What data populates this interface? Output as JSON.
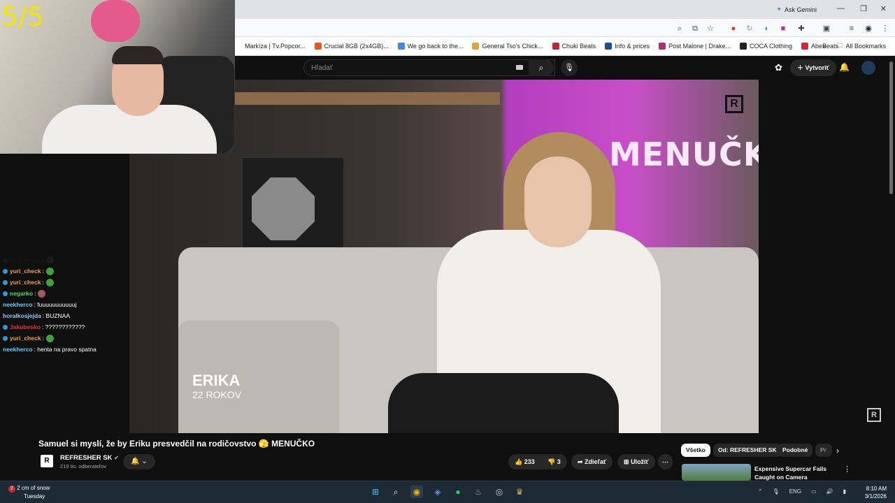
{
  "stream": {
    "counter": "5/5"
  },
  "chat": [
    {
      "user": "yuri_check",
      "text": ":",
      "color": "#2a2a2a",
      "badge": "#333",
      "emote": "#3a3a3a"
    },
    {
      "user": "yuri_check",
      "text": ":",
      "color": "#f0a33c",
      "badge": "#2f9ad6",
      "emote": "#3fa33a"
    },
    {
      "user": "yuri_check",
      "text": ":",
      "color": "#f0a33c",
      "badge": "#2f9ad6",
      "emote": "#3fa33a"
    },
    {
      "user": "negarko",
      "text": ":",
      "color": "#53d86a",
      "badge": "#2f9ad6",
      "emote": "#a05a5a"
    },
    {
      "user": "neekherco",
      "text": ": fuuuuuuuuuuuj",
      "color": "#62d1ff",
      "badge": "",
      "emote": ""
    },
    {
      "user": "horalkosjejda",
      "text": ": BUZNAA",
      "color": "#9ac6ff",
      "badge": "",
      "emote": ""
    },
    {
      "user": "Jakubesko",
      "text": ": ????????????",
      "color": "#e8323c",
      "badge": "#2f9ad6",
      "emote": ""
    },
    {
      "user": "yuri_check",
      "text": ":",
      "color": "#f0a33c",
      "badge": "#2f9ad6",
      "emote": "#3fa33a"
    },
    {
      "user": "neekherco",
      "text": ": henta na pravo spatna",
      "color": "#62d1ff",
      "badge": "",
      "emote": ""
    }
  ],
  "browser": {
    "ask_gemini": "Ask Gemini",
    "bookmarks": [
      {
        "label": "Markíza | Tv.Popcor...",
        "color": "#ffffff"
      },
      {
        "label": "Crucial 8GB (2x4GB)...",
        "color": "#e45a1e"
      },
      {
        "label": "We go back to the...",
        "color": "#4285f4"
      },
      {
        "label": "General Tso's Chick...",
        "color": "#d9a441"
      },
      {
        "label": "Chuki Beats",
        "color": "#c0263a"
      },
      {
        "label": "Info & prices",
        "color": "#1a4fa0"
      },
      {
        "label": "Post Malone | Drake...",
        "color": "#b0306e"
      },
      {
        "label": "COCA Clothing",
        "color": "#222222"
      },
      {
        "label": "AbeBeats",
        "color": "#d6263a"
      }
    ],
    "all_bookmarks": "All Bookmarks"
  },
  "youtube": {
    "search_placeholder": "Hľadať",
    "create_label": "Vytvoriť",
    "video": {
      "overlay_title": "MENUČK",
      "lower_third_name": "ERIKA",
      "lower_third_age": "22 ROKOV"
    },
    "title": "Samuel si myslí, že by Eriku presvedčil na rodičovstvo 🫣 MENUČKO",
    "channel": {
      "name": "REFRESHER SK",
      "subscribers": "219 tis. odberateľov",
      "logo": "R"
    },
    "actions": {
      "likes": "233",
      "dislikes": "3",
      "share": "Zdieľať",
      "save": "Uložiť"
    },
    "chips": [
      "Všetko",
      "Od: REFRESHER SK",
      "Podobné",
      "Pr"
    ],
    "recommendation": {
      "title": "Expensive Supercar Fails Caught on Camera"
    }
  },
  "taskbar": {
    "weather_temp": "2 cm of snow",
    "weather_day": "Tuesday",
    "weather_badge": "2",
    "lang": "ENG",
    "time": "8:10 AM",
    "date": "3/1/2026"
  }
}
